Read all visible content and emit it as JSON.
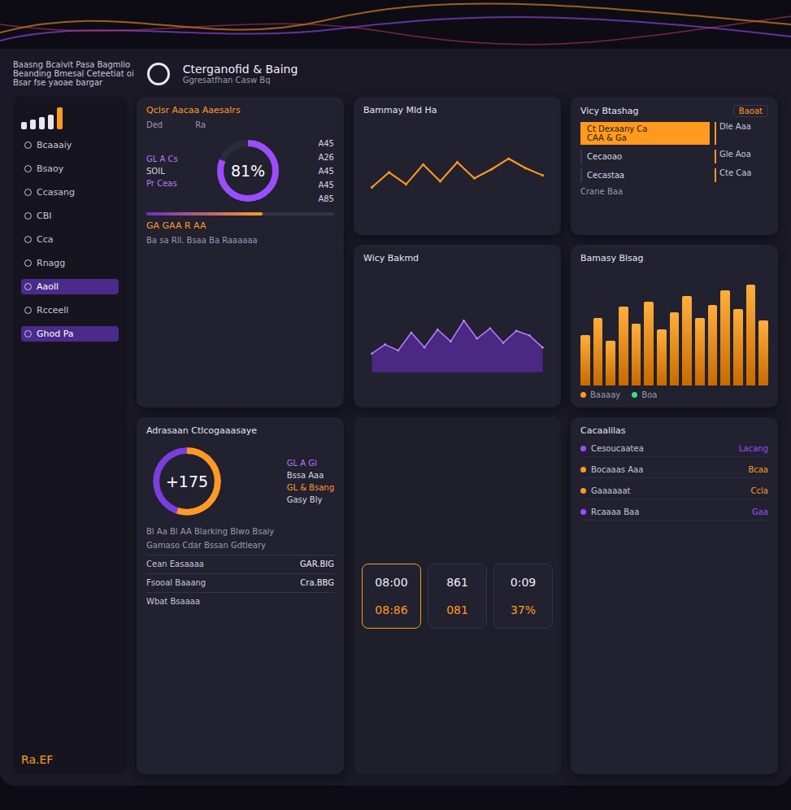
{
  "header": {
    "brand_lines": [
      "Baasng Bcaivit Pasa Bagmlio",
      "Beanding Bmesal Ceteetiat oi",
      "Bsar fse yaoae bargar"
    ],
    "title": "Cterganofid & Baing",
    "subtitle": "Ggresatfhan Casw Bq"
  },
  "sidebar": {
    "bars": [
      3,
      4,
      5,
      6,
      9
    ],
    "items": [
      {
        "label": "Bcaaaiy",
        "selected": false
      },
      {
        "label": "Bsaoy",
        "selected": false
      },
      {
        "label": "Ccasang",
        "selected": false
      },
      {
        "label": "CBI",
        "selected": false
      },
      {
        "label": "Cca",
        "selected": false
      },
      {
        "label": "Rnagg",
        "selected": false
      },
      {
        "label": "Aaoll",
        "selected": true
      },
      {
        "label": "Rcceell",
        "selected": false
      },
      {
        "label": "Ghod Pa",
        "selected": true
      }
    ],
    "footer": "Ra.EF"
  },
  "gauge_card": {
    "title": "Qclsr Aacaa Aaesalrs",
    "columns": [
      "Ded",
      "Ra"
    ],
    "value": "81%",
    "level": 0.81,
    "left_labels": [
      "GL A Cs",
      "SOIL",
      "Pr Ceas"
    ],
    "right_values": [
      "A45",
      "A26",
      "A45",
      "A45",
      "A85"
    ],
    "progress": 0.62,
    "caption": "GA GAA R AA",
    "footer": "Ba sa Rll. Bsaa Ba Raaaaaa"
  },
  "line_chart": {
    "title": "Bammay Mld Ha",
    "values": [
      30,
      55,
      35,
      68,
      40,
      72,
      45,
      60,
      78,
      62,
      50
    ]
  },
  "area_chart": {
    "title": "Wicy Bakmd",
    "values": [
      20,
      35,
      25,
      55,
      30,
      60,
      40,
      75,
      45,
      62,
      38,
      58,
      50,
      30
    ]
  },
  "bar_chart": {
    "title": "Bamasy Blsag",
    "values": [
      45,
      60,
      40,
      70,
      55,
      75,
      50,
      65,
      80,
      60,
      72,
      85,
      68,
      90,
      58
    ],
    "legend": [
      {
        "label": "Baaaay",
        "color": "#ff9a1f"
      },
      {
        "label": "Boa",
        "color": "#3ddc84"
      }
    ]
  },
  "tasks": {
    "title": "Vicy Btashag",
    "button": "Baoat",
    "rows": [
      {
        "label": "Ct Dexaany Ca",
        "sub": "CAA & Ga",
        "side": "Dle Aaa",
        "selected": true
      },
      {
        "label": "Cecaoao",
        "sub": "",
        "side": "Gle Aoa",
        "selected": false
      },
      {
        "label": "Cecastaa",
        "sub": "",
        "side": "Cte Caa",
        "selected": false
      }
    ],
    "footer": "Crane Baa"
  },
  "gauge2": {
    "title": "Adrasaan Ctlcogaaasaye",
    "value": "+175",
    "level": 0.55,
    "side_lines": [
      "GL A Gl",
      "Bssa Aaa",
      "GL & Bsang",
      "Gasy Bly"
    ],
    "text_lines": [
      "Bl Aa Bl AA Blarking Blwo Bsaiy",
      "Gamaso Cdar Bssan Gdtleary"
    ],
    "rows": [
      {
        "label": "Cean Easaaaa",
        "value": "GAR.BIG"
      },
      {
        "label": "Fsooal Baaang",
        "value": "Cra.BBG"
      },
      {
        "label": "Wbat Bsaaaa",
        "value": ""
      }
    ]
  },
  "tiles": [
    {
      "value": "08:00",
      "sub": "08:86",
      "highlight": true
    },
    {
      "value": "861",
      "sub": "081",
      "highlight": false
    },
    {
      "value": "0:09",
      "sub": "37%",
      "highlight": false
    }
  ],
  "list_card": {
    "title": "Cacaalilas",
    "rows": [
      {
        "label": "Cesoucaatea",
        "value": "Lacang",
        "color": "#9b4dff"
      },
      {
        "label": "Bocaaas Aaa",
        "value": "Bcaa",
        "color": "#ff9a1f"
      },
      {
        "label": "Gaaaaaat",
        "value": "Ccla",
        "color": "#ff9a1f"
      },
      {
        "label": "Rcaaaa Baa",
        "value": "Gaa",
        "color": "#9b4dff"
      }
    ]
  }
}
